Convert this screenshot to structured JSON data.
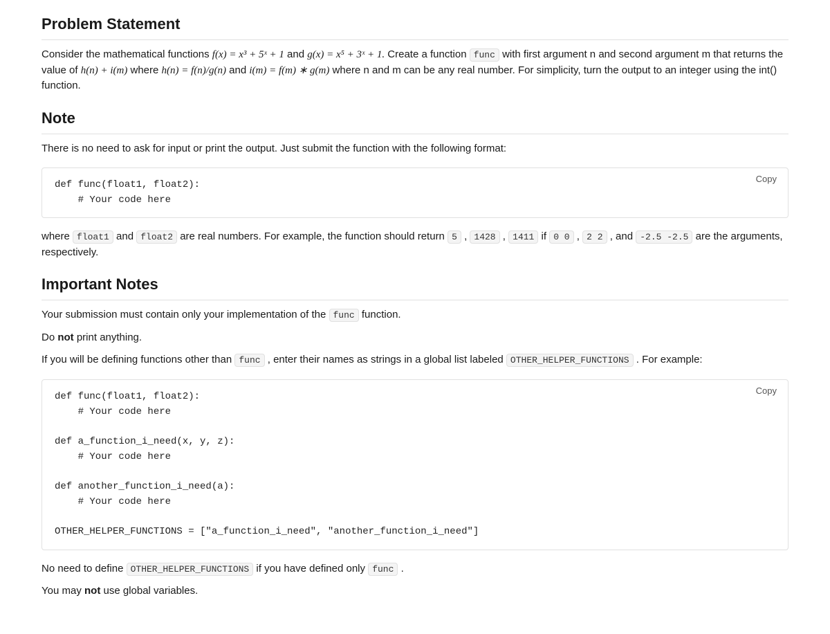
{
  "headings": {
    "problem": "Problem Statement",
    "note": "Note",
    "important": "Important Notes"
  },
  "problem": {
    "p1a": "Consider the mathematical functions ",
    "fx": "f(x) = x³ + 5ˣ + 1",
    "p1b": " and ",
    "gx": "g(x) = x⁵ + 3ˣ + 1.",
    "p1c": " Create a function ",
    "func_code": "func",
    "p1d": " with first argument n and second argument m that returns the value of ",
    "hm": "h(n) + i(m)",
    "p1e": " where ",
    "hn": "h(n) = f(n)/g(n)",
    "p1f": " and ",
    "im": "i(m) = f(m) ∗ g(m)",
    "p1g": "where n and m can be any real number. For simplicity, turn the output to an integer using the int() function."
  },
  "note": {
    "intro": "There is no need to ask for input or print the output. Just submit the function with the following format:",
    "code1": "def func(float1, float2):\n    # Your code here",
    "where_a": "where ",
    "float1": "float1",
    "where_b": " and ",
    "float2": "float2",
    "where_c": " are real numbers. For example, the function should return ",
    "r1": "5",
    "sep1": ", ",
    "r2": "1428",
    "sep2": ", ",
    "r3": "1411",
    "where_d": " if ",
    "a1": "0 0",
    "sep3": ", ",
    "a2": "2 2",
    "where_e": ", and ",
    "a3": "-2.5 -2.5",
    "where_f": " are the arguments, respectively."
  },
  "important": {
    "p1a": "Your submission must contain only your implementation of the ",
    "func_code": "func",
    "p1b": " function.",
    "p2a": "Do ",
    "p2b": "not",
    "p2c": " print anything.",
    "p3a": "If you will be defining functions other than ",
    "p3b": ", enter their names as strings in a global list labeled ",
    "other": "OTHER_HELPER_FUNCTIONS",
    "p3c": ". For example:",
    "code2": "def func(float1, float2):\n    # Your code here\n\ndef a_function_i_need(x, y, z):\n    # Your code here\n\ndef another_function_i_need(a):\n    # Your code here\n\nOTHER_HELPER_FUNCTIONS = [\"a_function_i_need\", \"another_function_i_need\"]",
    "p4a": "No need to define ",
    "p4b": " if you have defined only ",
    "p4c": ".",
    "p5a": "You may ",
    "p5b": "not",
    "p5c": " use global variables."
  },
  "buttons": {
    "copy": "Copy"
  }
}
